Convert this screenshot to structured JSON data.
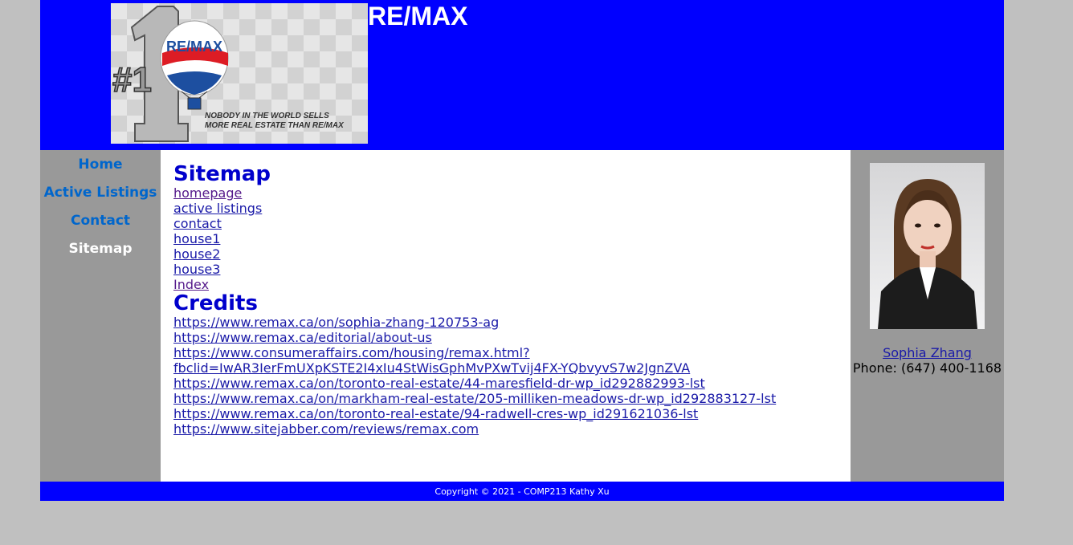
{
  "header": {
    "title": "RE/MAX",
    "logo": {
      "number": "#1",
      "brand": "RE/MAX",
      "tagline_1": "NOBODY IN THE WORLD SELLS",
      "tagline_2": "MORE REAL ESTATE THAN RE/MAX"
    }
  },
  "nav": {
    "items": [
      {
        "label": "Home"
      },
      {
        "label": "Active Listings"
      },
      {
        "label": "Contact"
      },
      {
        "label": "Sitemap"
      }
    ]
  },
  "main": {
    "sitemap_heading": "Sitemap",
    "sitemap_links": [
      "homepage",
      "active listings",
      "contact",
      "house1",
      "house2",
      "house3",
      "Index"
    ],
    "credits_heading": "Credits",
    "credit_links": [
      "https://www.remax.ca/on/sophia-zhang-120753-ag",
      "https://www.remax.ca/editorial/about-us",
      "https://www.consumeraffairs.com/housing/remax.html?",
      "fbclid=IwAR3IerFmUXpKSTE2I4xIu4StWisGphMvPXwTvij4FX-YQbvyvS7w2JgnZVA",
      "https://www.remax.ca/on/toronto-real-estate/44-maresfield-dr-wp_id292882993-lst",
      "https://www.remax.ca/on/markham-real-estate/205-milliken-meadows-dr-wp_id292883127-lst",
      "https://www.remax.ca/on/toronto-real-estate/94-radwell-cres-wp_id291621036-lst",
      "https://www.sitejabber.com/reviews/remax.com"
    ]
  },
  "agent": {
    "name": "Sophia Zhang",
    "phone": "Phone: (647) 400-1168"
  },
  "footer": {
    "text": "Copyright © 2021 - COMP213 Kathy Xu"
  },
  "colors": {
    "header_bg": "#0000ff",
    "sidebar_bg": "#999999",
    "nav_link": "#0066cc",
    "nav_active": "#ffffff",
    "heading": "#0000cc",
    "link": "#1a1aa8",
    "visited_link": "#551a8b",
    "page_bg": "#c0c0c0"
  }
}
